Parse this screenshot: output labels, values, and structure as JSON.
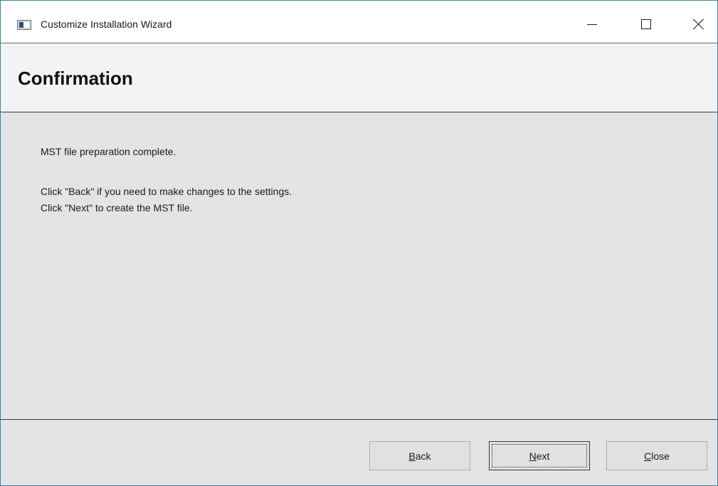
{
  "window": {
    "title": "Customize Installation Wizard"
  },
  "header": {
    "title": "Confirmation"
  },
  "content": {
    "line1": "MST file preparation complete.",
    "line2": "Click \"Back\" if you need to make changes to the settings.",
    "line3": "Click \"Next\" to create the MST file."
  },
  "footer": {
    "back": {
      "accel": "B",
      "rest": "ack"
    },
    "next": {
      "accel": "N",
      "rest": "ext"
    },
    "close": {
      "accel": "C",
      "rest": "lose"
    }
  },
  "icons": {
    "app": "app-window-icon",
    "minimize": "minimize-icon",
    "maximize": "maximize-icon",
    "close": "close-icon"
  },
  "colors": {
    "window_border": "#3c7fb1",
    "header_bg": "#f3f3f3",
    "content_bg": "#e4e4e4",
    "button_bg": "#e1e1e1"
  }
}
